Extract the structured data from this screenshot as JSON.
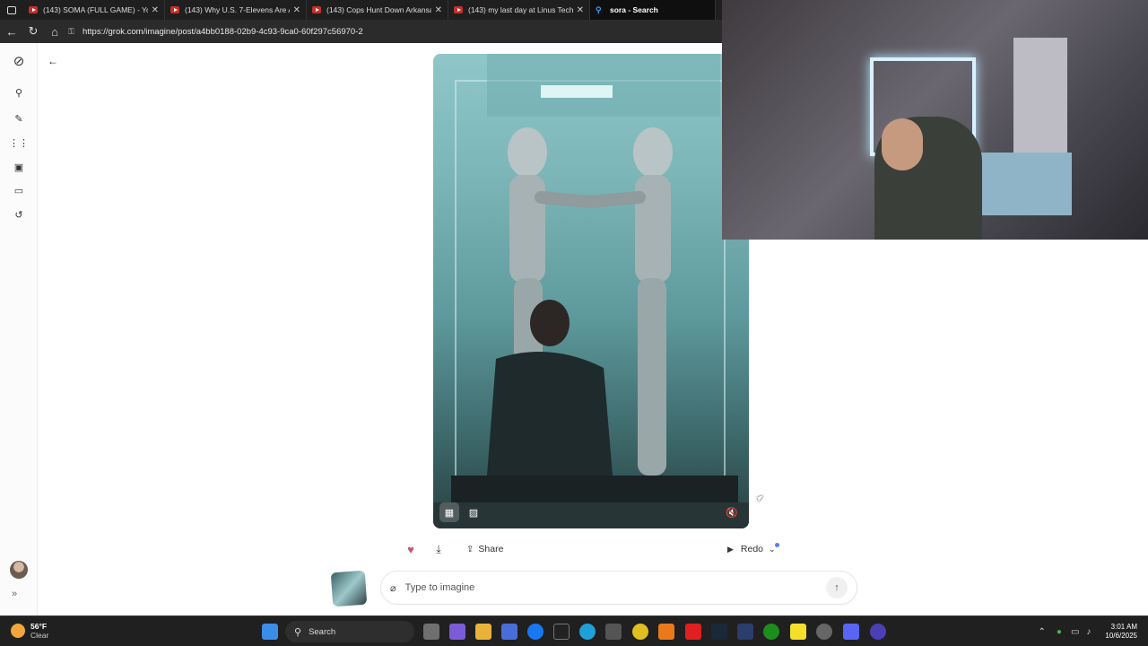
{
  "browser": {
    "tabs": [
      {
        "title": "(143) SOMA (FULL GAME) - YouT"
      },
      {
        "title": "(143) Why U.S. 7-Elevens Are Ad"
      },
      {
        "title": "(143) Cops Hunt Down Arkansas"
      },
      {
        "title": "(143) my last day at Linus Tech Ti"
      },
      {
        "title": "sora - Search"
      }
    ],
    "url": "https://grok.com/imagine/post/a4bb0188-02b9-4c93-9ca0-60f297c56970-2"
  },
  "actions": {
    "share_label": "Share",
    "redo_label": "Redo"
  },
  "prompt": {
    "placeholder": "Type to imagine"
  },
  "taskbar": {
    "weather_temp": "56°F",
    "weather_desc": "Clear",
    "search_label": "Search",
    "time": "3:01 AM",
    "date": "10/6/2025"
  },
  "colors": {
    "accent_dot": "#5b7bf0",
    "heart": "#c9566f"
  }
}
